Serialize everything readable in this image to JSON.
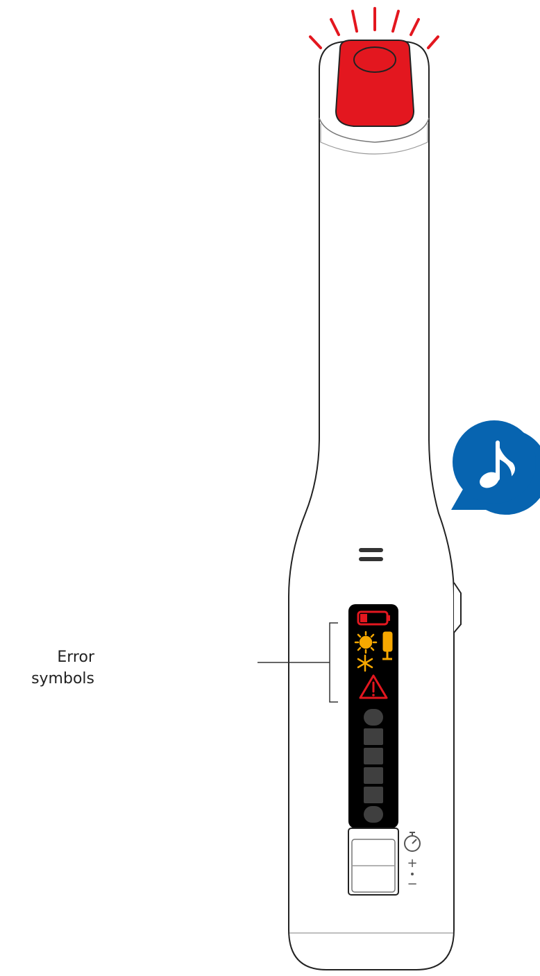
{
  "callout": {
    "line1": "Error",
    "line2": "symbols"
  },
  "colors": {
    "red_button": "#e3171f",
    "red_battery": "#e3171f",
    "warning_yellow": "#f7a800",
    "sound_bubble": "#0764b0",
    "display_bg": "#000000",
    "body_outline": "#222222",
    "segment_gray": "#3f3f3f"
  },
  "icons": {
    "power_button": "power-button-icon",
    "sound_bubble": "music-note-icon",
    "battery": "battery-low-icon",
    "sun": "sun-icon",
    "snowflake": "snowflake-icon",
    "brush_head": "brush-head-icon",
    "warning": "warning-triangle-icon",
    "timer": "stopwatch-icon"
  },
  "display": {
    "level_segments": 6
  },
  "side_labels": {
    "plus": "+",
    "minus": "−"
  }
}
